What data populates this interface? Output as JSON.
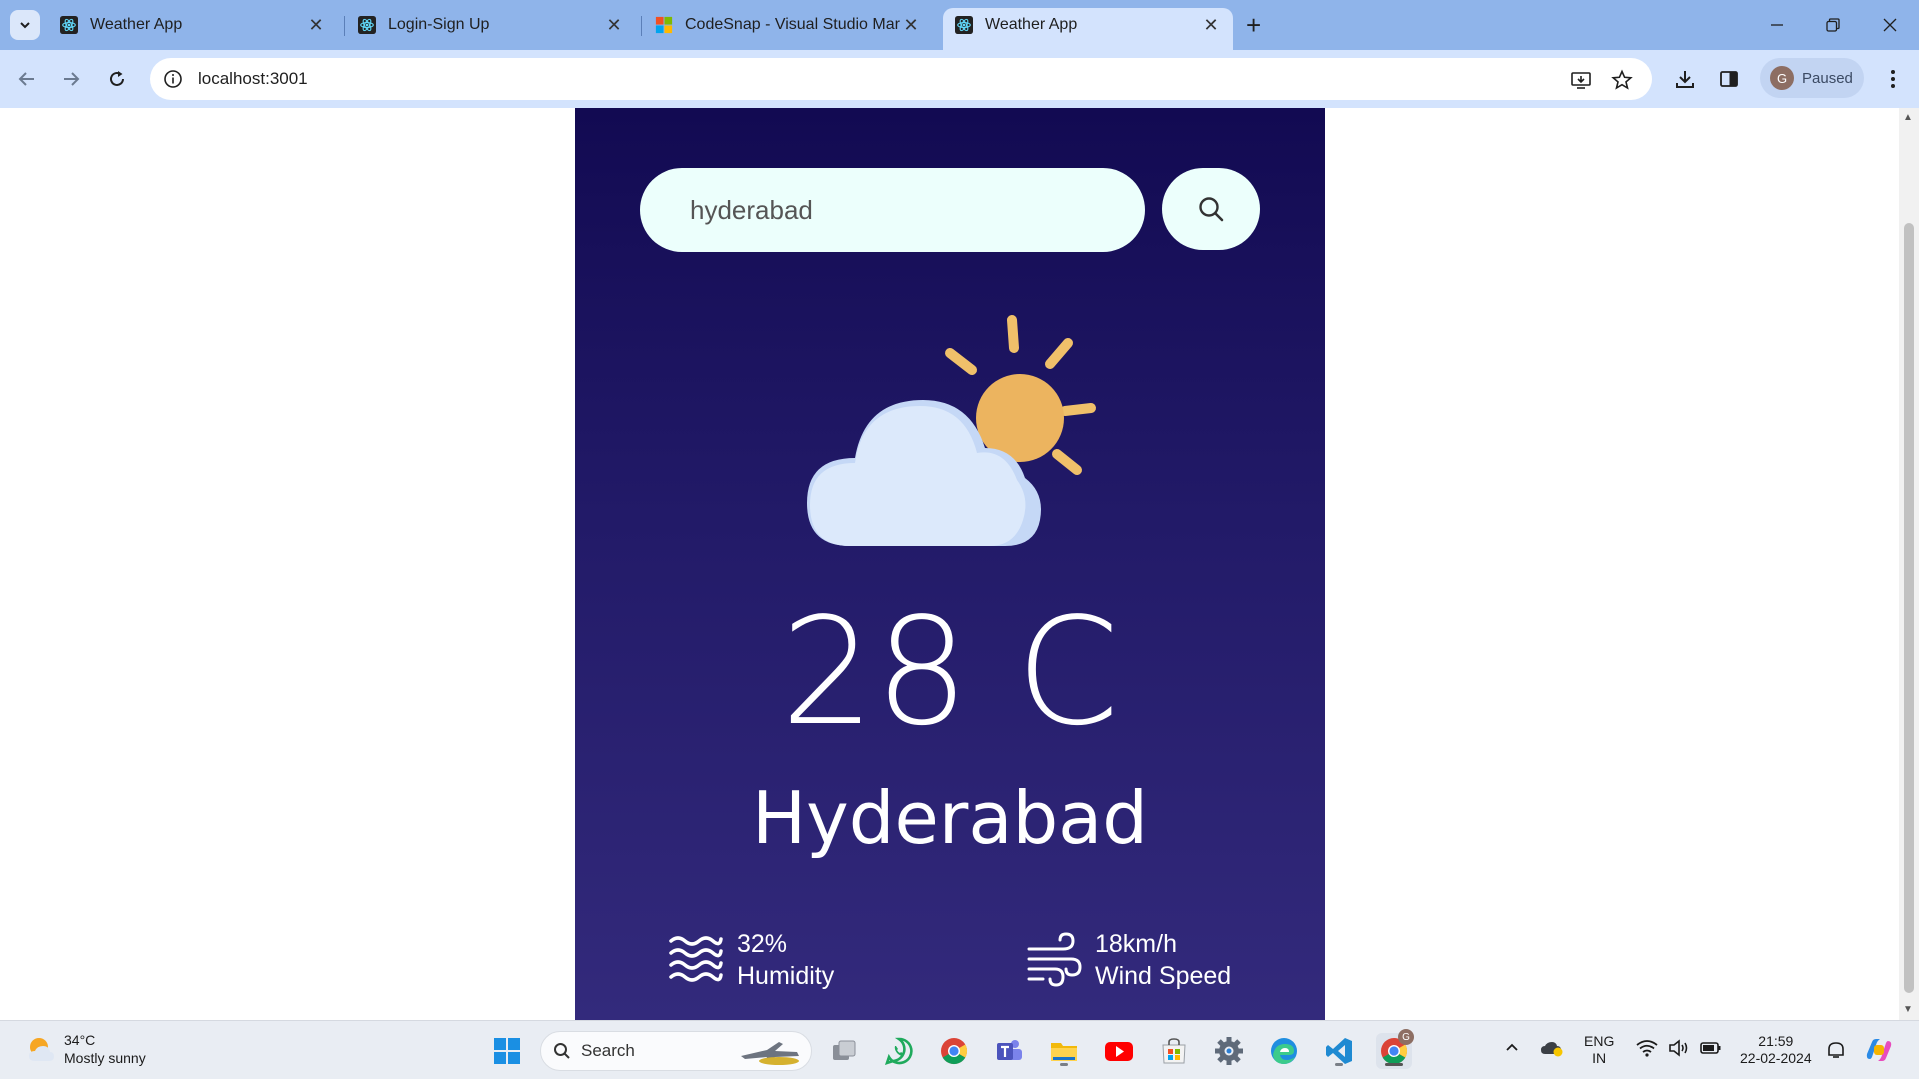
{
  "browser": {
    "tabs": [
      {
        "title": "Weather App",
        "favicon": "react-icon",
        "active": false
      },
      {
        "title": "Login-Sign Up",
        "favicon": "react-icon",
        "active": false
      },
      {
        "title": "CodeSnap - Visual Studio Mark",
        "favicon": "microsoft-icon",
        "active": false
      },
      {
        "title": "Weather App",
        "favicon": "react-icon",
        "active": true
      }
    ],
    "url": "localhost:3001",
    "profile": {
      "initial": "G",
      "status": "Paused"
    }
  },
  "weather": {
    "search": {
      "value": "hyderabad"
    },
    "temperature": "28 C",
    "city": "Hyderabad",
    "humidity": {
      "value": "32%",
      "label": "Humidity"
    },
    "wind": {
      "value": "18km/h",
      "label": "Wind Speed"
    },
    "icon": "partly-cloudy-icon",
    "colors": {
      "card_top": "#120a52",
      "card_bottom": "#332a7c",
      "sun": "#f0b35a",
      "cloud": "#dbe8fb",
      "input_bg": "#ecfffc"
    }
  },
  "taskbar": {
    "weather": {
      "temp": "34°C",
      "condition": "Mostly sunny"
    },
    "search_label": "Search",
    "language": {
      "top": "ENG",
      "bottom": "IN"
    },
    "clock": {
      "time": "21:59",
      "date": "22-02-2024"
    },
    "chrome_badge": "G"
  }
}
